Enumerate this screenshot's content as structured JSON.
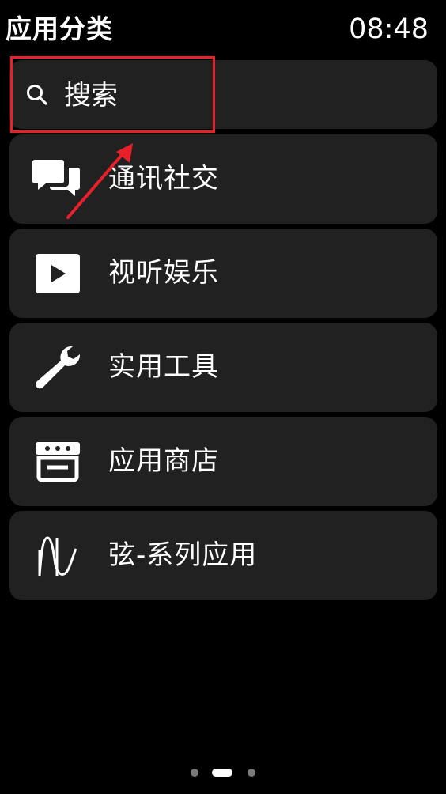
{
  "header": {
    "title": "应用分类",
    "time": "08:48"
  },
  "search": {
    "label": "搜索",
    "icon": "search-icon"
  },
  "categories": [
    {
      "label": "通讯社交",
      "icon": "chat-bubbles-icon"
    },
    {
      "label": "视听娱乐",
      "icon": "play-icon"
    },
    {
      "label": "实用工具",
      "icon": "wrench-icon"
    },
    {
      "label": "应用商店",
      "icon": "store-icon"
    },
    {
      "label": "弦-系列应用",
      "icon": "waveform-icon"
    }
  ],
  "annotation": {
    "color": "#e8202a"
  },
  "page_indicator": {
    "count": 3,
    "active_index": 1
  },
  "colors": {
    "background": "#000000",
    "card": "#212121",
    "text": "#ffffff"
  }
}
